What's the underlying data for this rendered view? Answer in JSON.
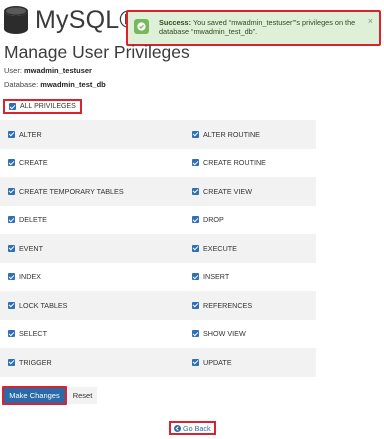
{
  "header": {
    "title": "MySQL® Databases",
    "icon": "database-icon"
  },
  "notification": {
    "type": "success",
    "strong": "Success:",
    "message": " You saved “mwadmin_testuser”’s privileges on the database “mwadmin_test_db”.",
    "close": "×",
    "colors": {
      "background": "#dff0d8",
      "badge": "#79b85a"
    }
  },
  "page": {
    "title": "Manage User Privileges",
    "user_label": "User:",
    "user_value": "mwadmin_testuser",
    "db_label": "Database:",
    "db_value": "mwadmin_test_db"
  },
  "all_privileges": {
    "label": "ALL PRIVILEGES",
    "checked": true
  },
  "privileges": [
    {
      "left": "ALTER",
      "right": "ALTER ROUTINE"
    },
    {
      "left": "CREATE",
      "right": "CREATE ROUTINE"
    },
    {
      "left": "CREATE TEMPORARY TABLES",
      "right": "CREATE VIEW"
    },
    {
      "left": "DELETE",
      "right": "DROP"
    },
    {
      "left": "EVENT",
      "right": "EXECUTE"
    },
    {
      "left": "INDEX",
      "right": "INSERT"
    },
    {
      "left": "LOCK TABLES",
      "right": "REFERENCES"
    },
    {
      "left": "SELECT",
      "right": "SHOW VIEW"
    },
    {
      "left": "TRIGGER",
      "right": "UPDATE"
    }
  ],
  "actions": {
    "make_changes": "Make Changes",
    "reset": "Reset",
    "go_back": "Go Back"
  },
  "colors": {
    "accent": "#2a6aa8",
    "checkbox": "#2f6fb4",
    "highlight_border": "#d9232e",
    "row_shade": "#f2f2f2"
  }
}
